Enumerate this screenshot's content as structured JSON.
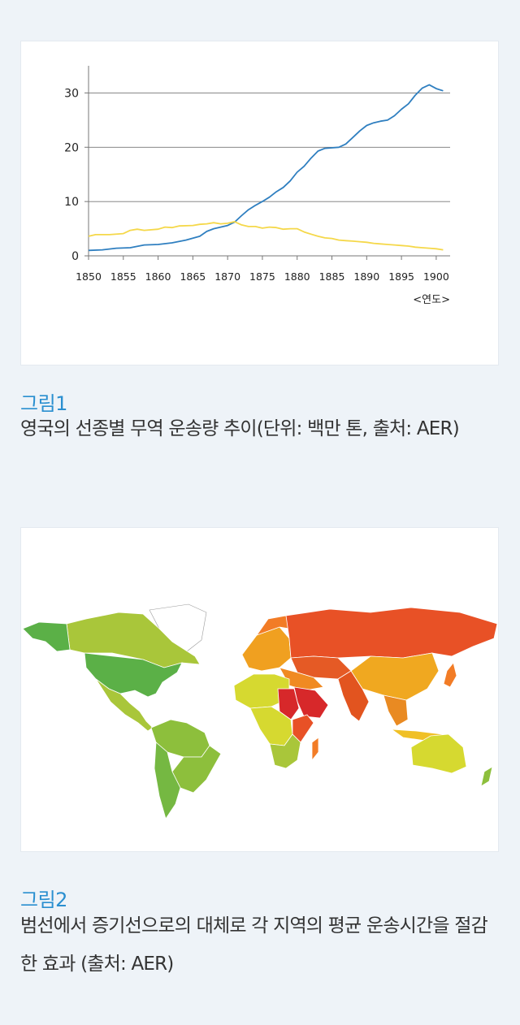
{
  "figure1": {
    "label": "그림1",
    "caption": "영국의 선종별 무역 운송량 추이(단위: 백만 톤, 출처: AER)"
  },
  "figure2": {
    "label": "그림2",
    "caption": "범선에서 증기선으로의 대체로 각 지역의 평균 운송시간을 절감한 효과 (출처: AER)"
  },
  "colors": {
    "steam": "#2f7fc0",
    "sail": "#f5d84a",
    "grid": "#777777",
    "map_low": "#5bb047",
    "map_mid": "#d6d930",
    "map_high": "#e64a1f"
  },
  "chart_data": {
    "type": "line",
    "x_unit": "<연도>",
    "xlim": [
      1850,
      1902
    ],
    "ylim": [
      0,
      35
    ],
    "xticks": [
      1850,
      1855,
      1860,
      1865,
      1870,
      1875,
      1880,
      1885,
      1890,
      1895,
      1900
    ],
    "yticks": [
      0,
      10,
      20,
      30
    ],
    "grid": "horizontal",
    "series": [
      {
        "key": "steam",
        "points": [
          [
            1850,
            1.0
          ],
          [
            1852,
            1.1
          ],
          [
            1854,
            1.4
          ],
          [
            1856,
            1.5
          ],
          [
            1858,
            2.0
          ],
          [
            1860,
            2.1
          ],
          [
            1862,
            2.4
          ],
          [
            1864,
            2.9
          ],
          [
            1866,
            3.6
          ],
          [
            1867,
            4.5
          ],
          [
            1868,
            5.0
          ],
          [
            1870,
            5.6
          ],
          [
            1871,
            6.2
          ],
          [
            1872,
            7.4
          ],
          [
            1873,
            8.5
          ],
          [
            1874,
            9.3
          ],
          [
            1875,
            10.0
          ],
          [
            1876,
            10.8
          ],
          [
            1877,
            11.8
          ],
          [
            1878,
            12.6
          ],
          [
            1879,
            13.8
          ],
          [
            1880,
            15.4
          ],
          [
            1881,
            16.5
          ],
          [
            1882,
            18.0
          ],
          [
            1883,
            19.3
          ],
          [
            1884,
            19.8
          ],
          [
            1885,
            19.9
          ],
          [
            1886,
            20.0
          ],
          [
            1887,
            20.6
          ],
          [
            1888,
            21.8
          ],
          [
            1889,
            23.0
          ],
          [
            1890,
            24.0
          ],
          [
            1891,
            24.5
          ],
          [
            1892,
            24.8
          ],
          [
            1893,
            25.0
          ],
          [
            1894,
            25.8
          ],
          [
            1895,
            27.0
          ],
          [
            1896,
            28.0
          ],
          [
            1897,
            29.6
          ],
          [
            1898,
            30.9
          ],
          [
            1899,
            31.5
          ],
          [
            1900,
            30.8
          ],
          [
            1901,
            30.4
          ]
        ]
      },
      {
        "key": "sail",
        "points": [
          [
            1850,
            3.6
          ],
          [
            1851,
            3.9
          ],
          [
            1853,
            3.9
          ],
          [
            1855,
            4.1
          ],
          [
            1856,
            4.7
          ],
          [
            1857,
            4.9
          ],
          [
            1858,
            4.7
          ],
          [
            1860,
            4.9
          ],
          [
            1861,
            5.3
          ],
          [
            1862,
            5.2
          ],
          [
            1863,
            5.5
          ],
          [
            1865,
            5.6
          ],
          [
            1866,
            5.8
          ],
          [
            1867,
            5.9
          ],
          [
            1868,
            6.1
          ],
          [
            1869,
            5.9
          ],
          [
            1870,
            6.0
          ],
          [
            1871,
            6.3
          ],
          [
            1872,
            5.7
          ],
          [
            1873,
            5.4
          ],
          [
            1874,
            5.4
          ],
          [
            1875,
            5.1
          ],
          [
            1876,
            5.3
          ],
          [
            1877,
            5.2
          ],
          [
            1878,
            4.9
          ],
          [
            1879,
            5.0
          ],
          [
            1880,
            5.0
          ],
          [
            1881,
            4.4
          ],
          [
            1882,
            4.0
          ],
          [
            1883,
            3.6
          ],
          [
            1884,
            3.3
          ],
          [
            1885,
            3.2
          ],
          [
            1886,
            2.9
          ],
          [
            1887,
            2.8
          ],
          [
            1888,
            2.7
          ],
          [
            1889,
            2.6
          ],
          [
            1890,
            2.5
          ],
          [
            1891,
            2.3
          ],
          [
            1892,
            2.2
          ],
          [
            1893,
            2.1
          ],
          [
            1894,
            2.0
          ],
          [
            1895,
            1.9
          ],
          [
            1896,
            1.8
          ],
          [
            1897,
            1.6
          ],
          [
            1898,
            1.5
          ],
          [
            1899,
            1.4
          ],
          [
            1900,
            1.3
          ],
          [
            1901,
            1.1
          ]
        ]
      }
    ]
  }
}
